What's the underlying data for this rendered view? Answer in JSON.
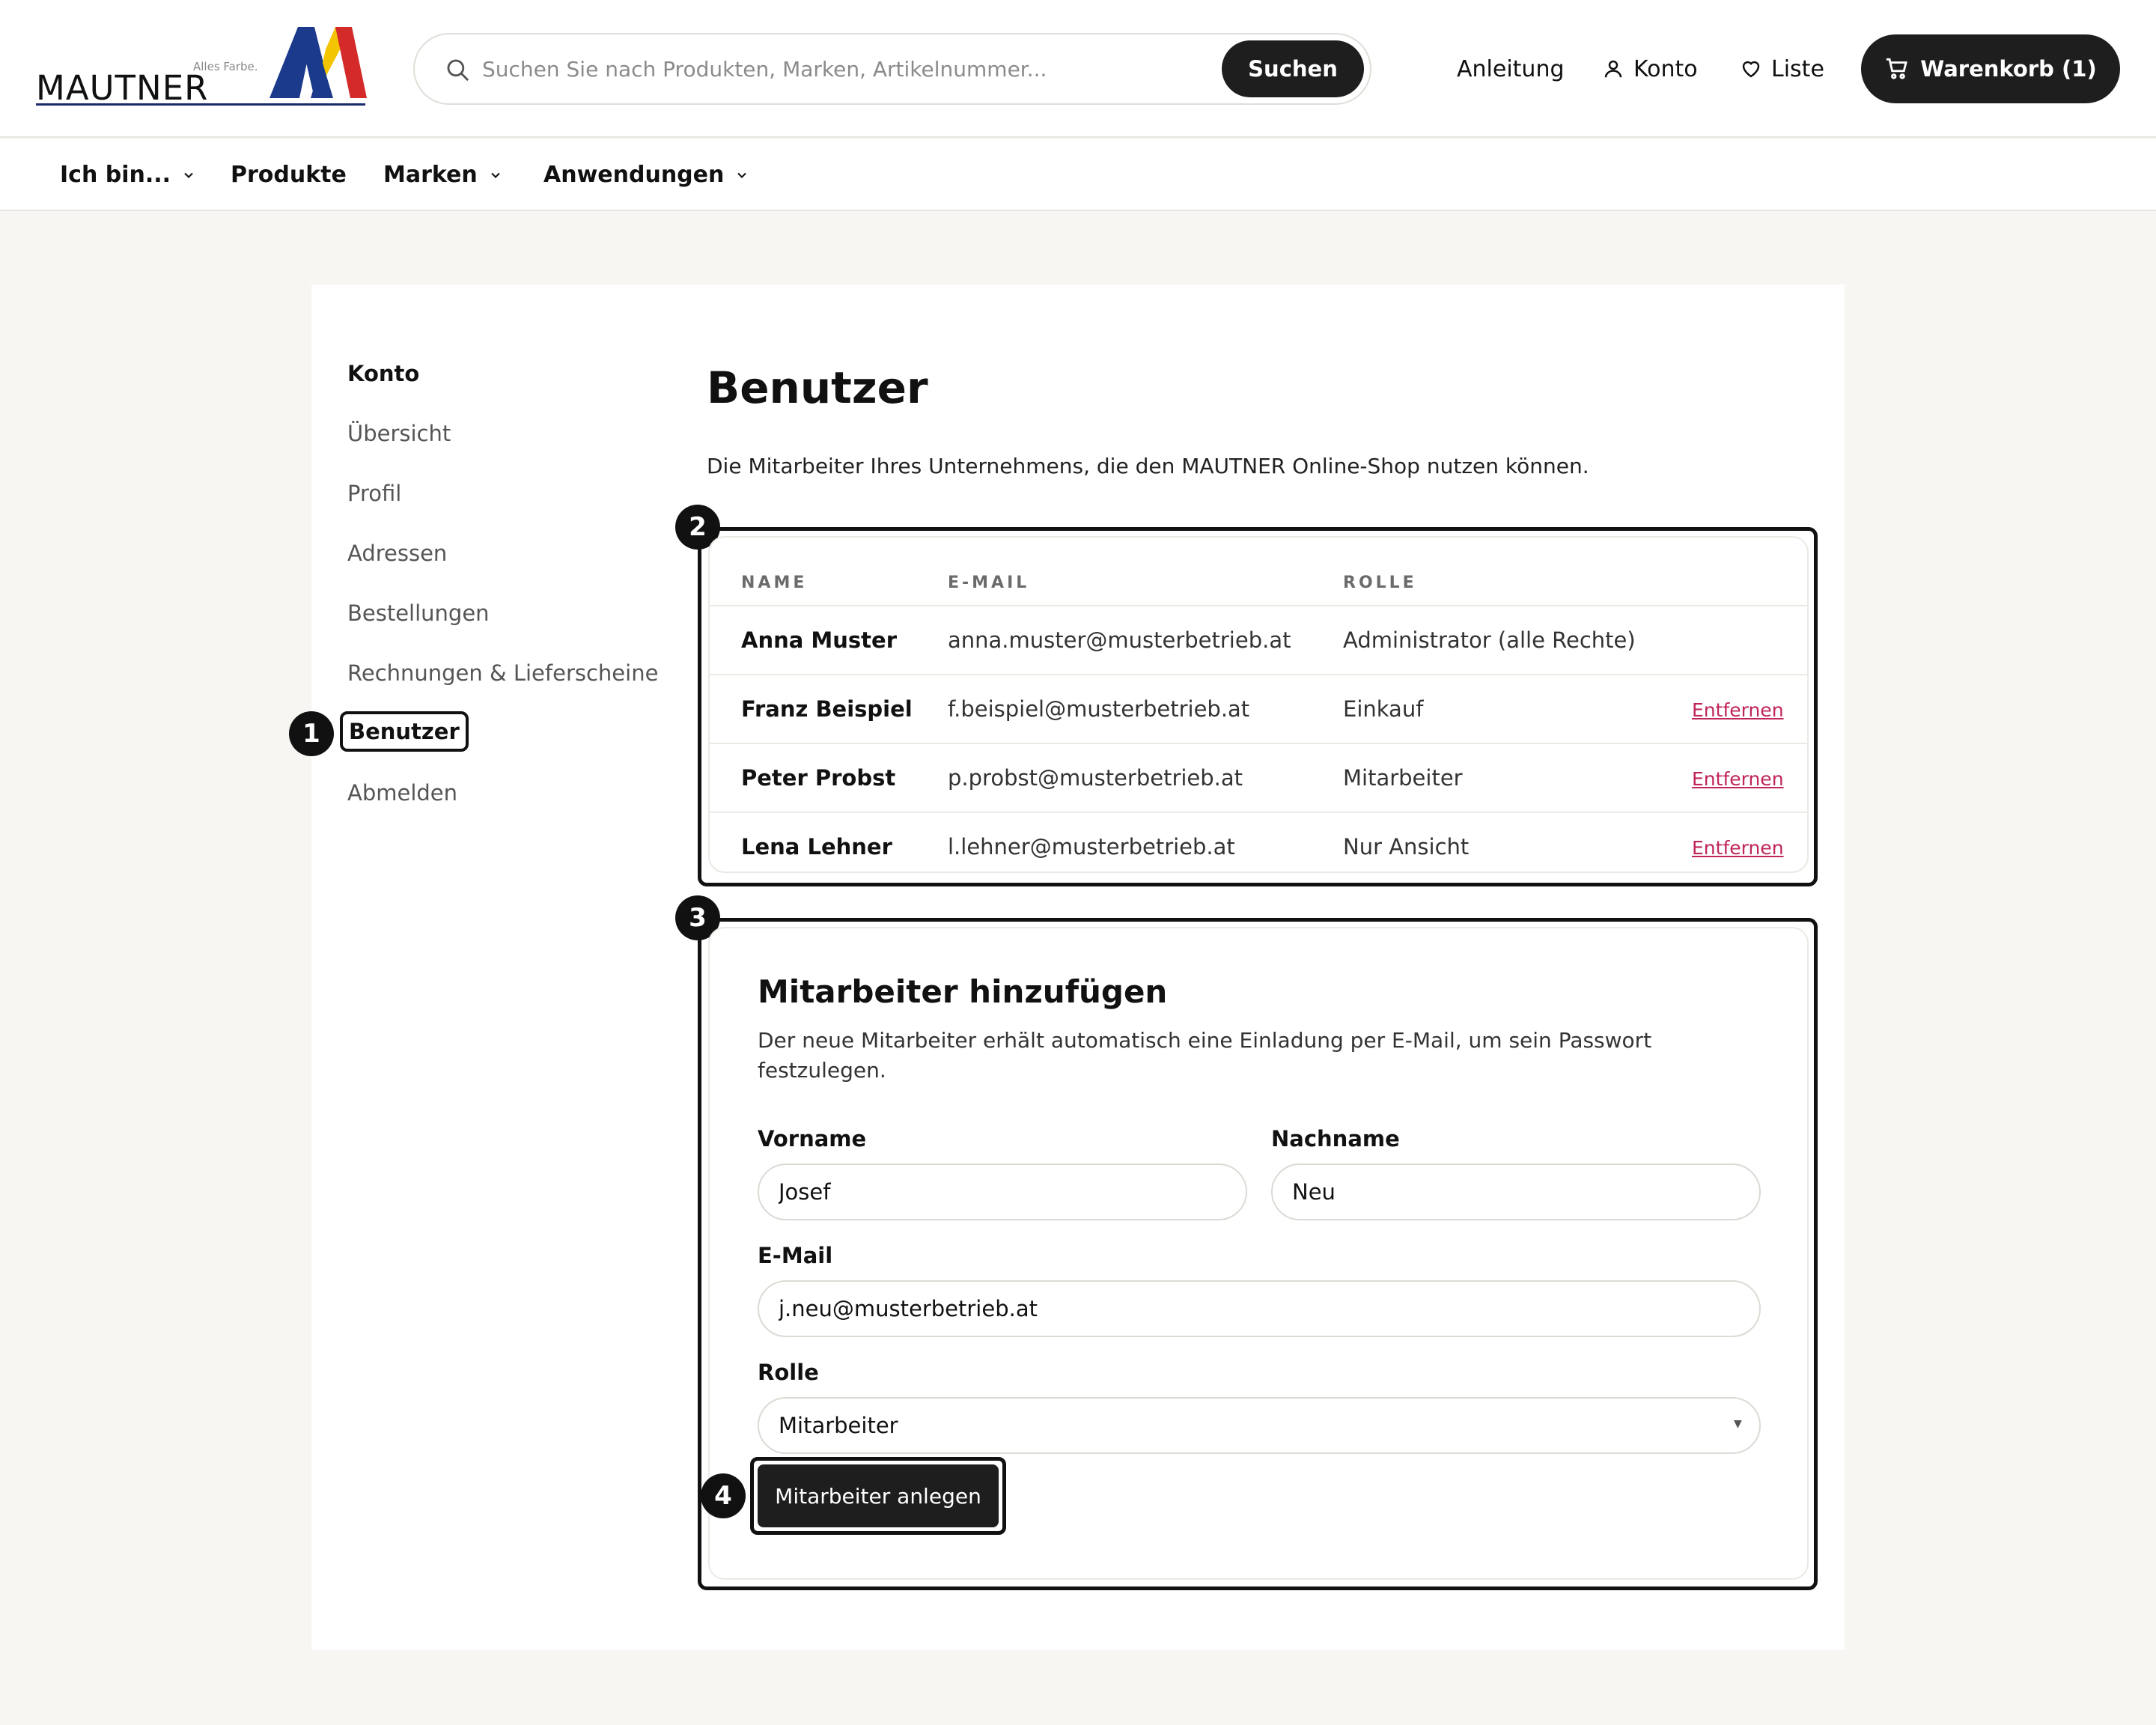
{
  "header": {
    "logo_text": "MAUTNER",
    "logo_tagline": "Alles Farbe.",
    "search_placeholder": "Suchen Sie nach Produkten, Marken, Artikelnummer...",
    "search_button": "Suchen",
    "guide_link": "Anleitung",
    "account_link": "Konto",
    "wishlist_link": "Liste",
    "cart_label": "Warenkorb (1)"
  },
  "nav": {
    "items": [
      "Ich bin...",
      "Produkte",
      "Marken",
      "Anwendungen"
    ]
  },
  "sidebar": {
    "heading": "Konto",
    "items": [
      "Übersicht",
      "Profil",
      "Adressen",
      "Bestellungen",
      "Rechnungen & Lieferscheine",
      "Benutzer",
      "Abmelden"
    ],
    "active": "Benutzer"
  },
  "page": {
    "title": "Benutzer",
    "description": "Die Mitarbeiter Ihres Unternehmens, die den MAUTNER Online-Shop nutzen können."
  },
  "users_table": {
    "headers": [
      "NAME",
      "E-MAIL",
      "ROLLE"
    ],
    "remove_label": "Entfernen",
    "rows": [
      {
        "name": "Anna Muster",
        "email": "anna.muster@musterbetrieb.at",
        "role": "Administrator (alle Rechte)"
      },
      {
        "name": "Franz Beispiel",
        "email": "f.beispiel@musterbetrieb.at",
        "role": "Einkauf"
      },
      {
        "name": "Peter Probst",
        "email": "p.probst@musterbetrieb.at",
        "role": "Mitarbeiter"
      },
      {
        "name": "Lena Lehner",
        "email": "l.lehner@musterbetrieb.at",
        "role": "Nur Ansicht"
      }
    ]
  },
  "add_form": {
    "title": "Mitarbeiter hinzufügen",
    "description": "Der neue Mitarbeiter erhält automatisch eine Einladung per E-Mail, um sein Passwort festzulegen.",
    "first_name_label": "Vorname",
    "first_name_value": "Josef",
    "last_name_label": "Nachname",
    "last_name_value": "Neu",
    "email_label": "E-Mail",
    "email_value": "j.neu@musterbetrieb.at",
    "role_label": "Rolle",
    "role_value": "Mitarbeiter",
    "submit_label": "Mitarbeiter anlegen"
  },
  "annotations": [
    "1",
    "2",
    "3",
    "4"
  ],
  "colors": {
    "accent_dark": "#1e1e1e",
    "link_remove": "#c0265a",
    "page_bg": "#f7f6f2"
  }
}
